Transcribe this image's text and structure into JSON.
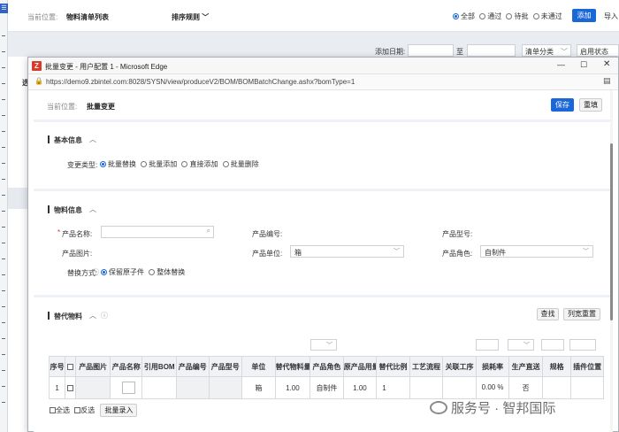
{
  "background_page": {
    "location_label": "当前位置:",
    "location_value": "物料清单列表",
    "sort_label": "排序规则",
    "filters": [
      "全部",
      "通过",
      "待批",
      "未通过"
    ],
    "add_button": "添加",
    "import_button": "导入",
    "add_date_label": "添加日期:",
    "to_label": "至",
    "category_select": "清单分类",
    "status_select": "启用状态",
    "col_header_fragment": "选"
  },
  "window": {
    "title": "批量变更 - 用户配置 1 - Microsoft Edge",
    "url": "https://demo9.zbintel.com:8028/SYSN/view/produceV2/BOM/BOMBatchChange.ashx?bomType=1"
  },
  "page": {
    "location_label": "当前位置:",
    "location_value": "批量变更",
    "save_button": "保存",
    "reset_button": "重填"
  },
  "basic_info": {
    "title": "基本信息",
    "change_type_label": "变更类型:",
    "change_type_options": [
      "批量替换",
      "批量添加",
      "直接添加",
      "批量删除"
    ],
    "selected_option": "批量替换"
  },
  "material_info": {
    "title": "物料信息",
    "product_name_label": "产品名称:",
    "product_code_label": "产品编号:",
    "product_model_label": "产品型号:",
    "product_image_label": "产品图片:",
    "product_unit_label": "产品单位:",
    "product_unit_value": "箱",
    "product_role_label": "产品角色:",
    "product_role_value": "自制件",
    "replace_mode_label": "替换方式:",
    "replace_mode_options": [
      "保留原子件",
      "整体替换"
    ],
    "selected_mode": "保留原子件"
  },
  "substitute": {
    "title": "替代物料",
    "search_button": "查找",
    "reset_width_button": "列宽重置",
    "columns": [
      "序号",
      "",
      "产品图片",
      "产品名称",
      "引用BOM",
      "产品编号",
      "产品型号",
      "单位",
      "替代物料量",
      "产品角色",
      "原产品用量",
      "替代比例",
      "工艺流程",
      "关联工序",
      "损耗率",
      "生产直送",
      "规格",
      "插件位置"
    ],
    "row": {
      "index": "1",
      "unit": "箱",
      "qty": "1.00",
      "role": "自制件",
      "orig_qty": "1.00",
      "ratio": "1",
      "loss": "0.00 %",
      "direct": "否"
    },
    "select_all": "全选",
    "invert": "反选",
    "batch_entry": "批量录入"
  },
  "watermark": "服务号 · 智邦国际",
  "colors": {
    "accent": "#1a67d8",
    "edge_icon": "#d83b2a"
  }
}
